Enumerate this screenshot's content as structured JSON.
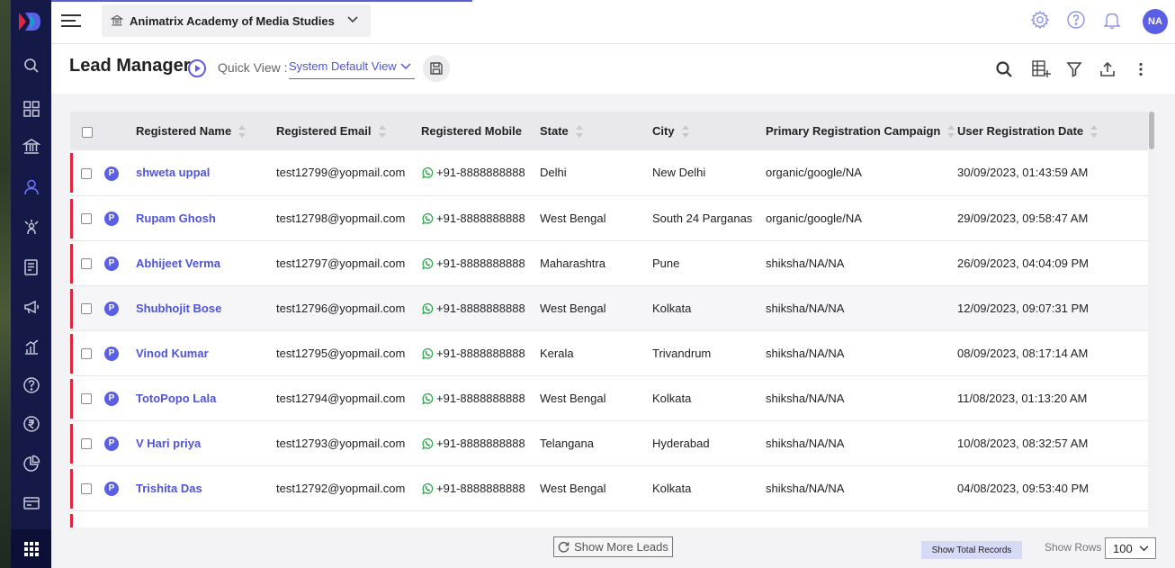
{
  "org": {
    "name": "Animatrix Academy of Media Studies"
  },
  "user": {
    "initials": "NA"
  },
  "page": {
    "title": "Lead Manager",
    "quick_view_label": "Quick View :",
    "quick_view_value": "System Default View"
  },
  "table": {
    "columns": [
      "Registered Name",
      "Registered Email",
      "Registered Mobile",
      "State",
      "City",
      "Primary Registration Campaign",
      "User Registration Date"
    ],
    "rows": [
      {
        "badge": "P",
        "name": "shweta uppal",
        "email": "test12799@yopmail.com",
        "mobile": "+91-8888888888",
        "state": "Delhi",
        "city": "New Delhi",
        "campaign": "organic/google/NA",
        "date": "30/09/2023, 01:43:59 AM"
      },
      {
        "badge": "P",
        "name": "Rupam Ghosh",
        "email": "test12798@yopmail.com",
        "mobile": "+91-8888888888",
        "state": "West Bengal",
        "city": "South 24 Parganas",
        "campaign": "organic/google/NA",
        "date": "29/09/2023, 09:58:47 AM"
      },
      {
        "badge": "P",
        "name": "Abhijeet Verma",
        "email": "test12797@yopmail.com",
        "mobile": "+91-8888888888",
        "state": "Maharashtra",
        "city": "Pune",
        "campaign": "shiksha/NA/NA",
        "date": "26/09/2023, 04:04:09 PM"
      },
      {
        "badge": "P",
        "name": "Shubhojit Bose",
        "email": "test12796@yopmail.com",
        "mobile": "+91-8888888888",
        "state": "West Bengal",
        "city": "Kolkata",
        "campaign": "shiksha/NA/NA",
        "date": "12/09/2023, 09:07:31 PM"
      },
      {
        "badge": "P",
        "name": "Vinod Kumar",
        "email": "test12795@yopmail.com",
        "mobile": "+91-8888888888",
        "state": "Kerala",
        "city": "Trivandrum",
        "campaign": "shiksha/NA/NA",
        "date": "08/09/2023, 08:17:14 AM"
      },
      {
        "badge": "P",
        "name": "TotoPopo Lala",
        "email": "test12794@yopmail.com",
        "mobile": "+91-8888888888",
        "state": "West Bengal",
        "city": "Kolkata",
        "campaign": "shiksha/NA/NA",
        "date": "11/08/2023, 01:13:20 AM"
      },
      {
        "badge": "P",
        "name": "V Hari priya",
        "email": "test12793@yopmail.com",
        "mobile": "+91-8888888888",
        "state": "Telangana",
        "city": "Hyderabad",
        "campaign": "shiksha/NA/NA",
        "date": "10/08/2023, 08:32:57 AM"
      },
      {
        "badge": "P",
        "name": "Trishita Das",
        "email": "test12792@yopmail.com",
        "mobile": "+91-8888888888",
        "state": "West Bengal",
        "city": "Kolkata",
        "campaign": "shiksha/NA/NA",
        "date": "04/08/2023, 09:53:40 PM"
      }
    ],
    "row_more": "•••"
  },
  "footer": {
    "show_more": "Show More Leads",
    "show_total": "Show Total Records",
    "show_rows_label": "Show Rows",
    "show_rows_value": "100"
  },
  "colors": {
    "accent": "#5b5fe6",
    "rail": "#141948",
    "flag": "#e0263d",
    "link": "#4f54d8"
  }
}
